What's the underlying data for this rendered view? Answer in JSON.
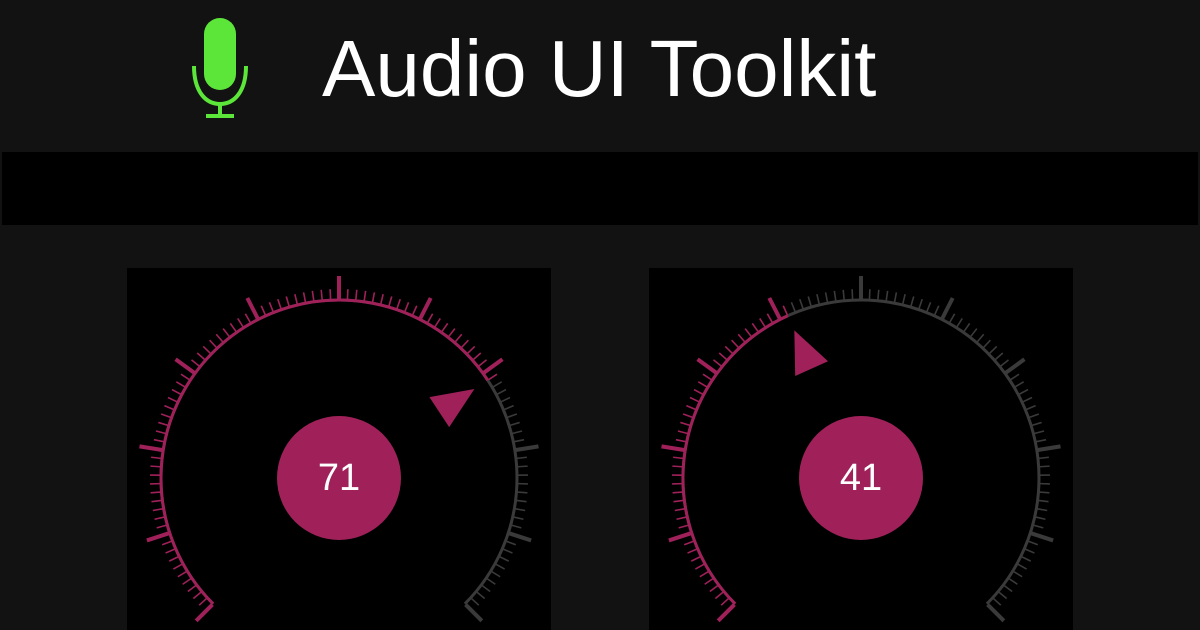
{
  "header": {
    "title": "Audio UI Toolkit",
    "icon": "microphone-icon",
    "icon_color": "#5ce63a"
  },
  "colors": {
    "accent": "#a0215a",
    "track": "#3a3a3a",
    "panel_bg": "#000000",
    "page_bg": "#121212"
  },
  "knobs": [
    {
      "name": "knob-left",
      "value": "71",
      "level": 0.71
    },
    {
      "name": "knob-right",
      "value": "41",
      "level": 0.41
    }
  ]
}
